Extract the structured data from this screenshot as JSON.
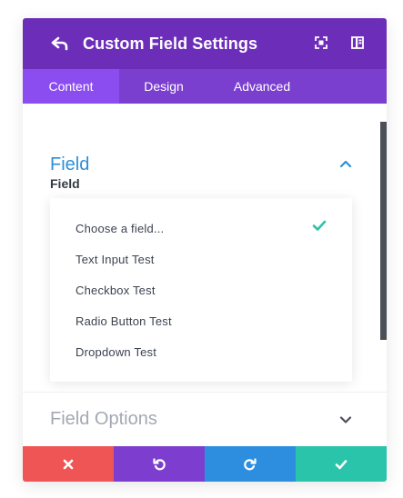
{
  "header": {
    "title": "Custom Field Settings",
    "back_icon": "back-arrow-icon",
    "expand_icon": "fullscreen-icon",
    "layout_icon": "sidebar-layout-icon",
    "bg_color": "#6c2eb9"
  },
  "tabs": [
    {
      "label": "Content",
      "active": true
    },
    {
      "label": "Design",
      "active": false
    },
    {
      "label": "Advanced",
      "active": false
    }
  ],
  "sections": {
    "field": {
      "title": "Field",
      "expanded": true,
      "title_color": "#2e8fd6",
      "label": "Field",
      "options": [
        "Choose a field...",
        "Text Input Test",
        "Checkbox Test",
        "Radio Button Test",
        "Dropdown Test"
      ],
      "selected": "Choose a field..."
    },
    "field_options": {
      "title": "Field Options",
      "expanded": false,
      "title_color": "#a3a8b3"
    }
  },
  "footer": {
    "buttons": [
      {
        "name": "cancel",
        "icon": "close-icon",
        "color": "#ef5555"
      },
      {
        "name": "undo",
        "icon": "undo-icon",
        "color": "#7d3ecf"
      },
      {
        "name": "redo",
        "icon": "redo-icon",
        "color": "#2d8ee0"
      },
      {
        "name": "save",
        "icon": "check-icon",
        "color": "#29c4a9"
      }
    ]
  }
}
